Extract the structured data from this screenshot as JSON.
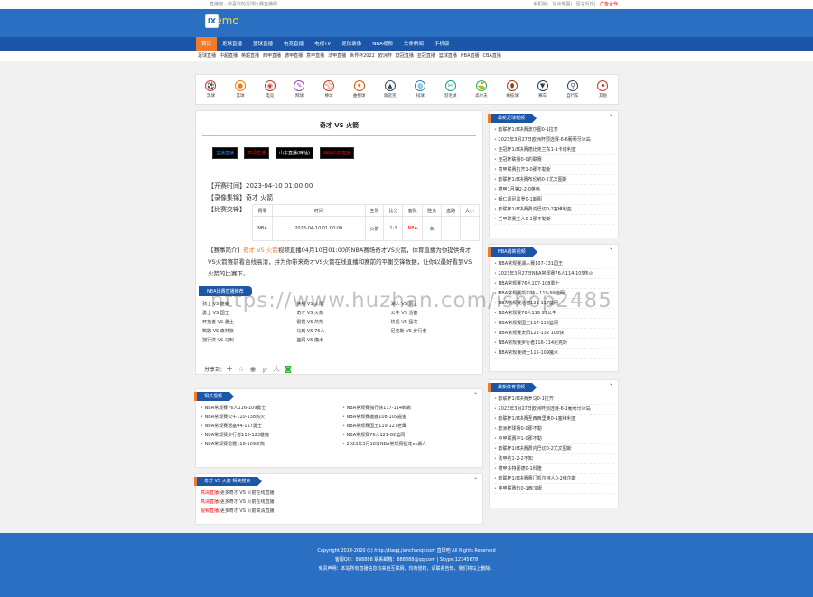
{
  "topbar": {
    "left": "直播吧 - 你喜欢的足球比赛直播网",
    "links": [
      "手机版",
      "站点地图",
      "留言反馈"
    ],
    "ad": "广告合作"
  },
  "logo": {
    "mark": "IX",
    "text": "Demo"
  },
  "nav": [
    "首页",
    "足球直播",
    "篮球直播",
    "电竞直播",
    "电视TV",
    "足球录像",
    "NBA视频",
    "头条新闻",
    "手机版"
  ],
  "subnav": [
    "足球直播",
    "中超直播",
    "英超直播",
    "西甲直播",
    "德甲直播",
    "意甲直播",
    "法甲直播",
    "世界杯2022",
    "欧洲杯",
    "欧冠直播",
    "亚冠直播",
    "篮球直播",
    "NBA直播",
    "CBA直播"
  ],
  "sports": [
    {
      "label": "足球",
      "icon": "soccer-icon",
      "color": "#c0392b",
      "glyph": "⚽"
    },
    {
      "label": "篮球",
      "icon": "basketball-icon",
      "color": "#e67e22",
      "glyph": "●"
    },
    {
      "label": "电竞",
      "icon": "esports-icon",
      "color": "#c0392b",
      "glyph": "◉"
    },
    {
      "label": "网球",
      "icon": "tennis-icon",
      "color": "#8e44ad",
      "glyph": "✎"
    },
    {
      "label": "棒球",
      "icon": "baseball-icon",
      "color": "#c0392b",
      "glyph": "⚾"
    },
    {
      "label": "曲棍球",
      "icon": "hockey-icon",
      "color": "#d35400",
      "glyph": "✶"
    },
    {
      "label": "斯诺克",
      "icon": "snooker-icon",
      "color": "#34495e",
      "glyph": "▲"
    },
    {
      "label": "排球",
      "icon": "volleyball-icon",
      "color": "#2980b9",
      "glyph": "◍"
    },
    {
      "label": "羽毛球",
      "icon": "badminton-icon",
      "color": "#16a085",
      "glyph": "✂"
    },
    {
      "label": "高尔夫",
      "icon": "golf-icon",
      "color": "#27ae60",
      "glyph": "⛳"
    },
    {
      "label": "橄榄球",
      "icon": "rugby-icon",
      "color": "#8b4513",
      "glyph": "⬮"
    },
    {
      "label": "赛车",
      "icon": "racing-icon",
      "color": "#2c3e50",
      "glyph": "▼"
    },
    {
      "label": "自行车",
      "icon": "cycling-icon",
      "color": "#2c3e50",
      "glyph": "⚲"
    },
    {
      "label": "其他",
      "icon": "other-sports-icon",
      "color": "#c0392b",
      "glyph": "♦"
    }
  ],
  "match": {
    "title": "奇才 VS 火箭",
    "buttons": [
      {
        "label": "主播直播",
        "color": "#3a7bd5"
      },
      {
        "label": "高清直播",
        "color": "#e00"
      },
      {
        "label": "山东直播(咪咕)",
        "color": "#fff"
      },
      {
        "label": "咪咕山东直播",
        "color": "#e00"
      }
    ],
    "time_label": "【开赛时间】",
    "time": "2023-04-10 01:00:00",
    "team_label": "【录像集锦】",
    "teams": "奇才 火箭",
    "odds_label": "【比赛交锋】",
    "table_head": [
      "赛事",
      "时间",
      "主队",
      "比分",
      "客队",
      "胜负",
      "盘路",
      "大小"
    ],
    "table_row": [
      "NBA",
      "2023-04-10 01:00:00",
      "火箭",
      "1:2",
      "NBA",
      "负",
      "",
      ""
    ],
    "intro_label": "【赛事简介】",
    "intro_hl": "奇才 VS 火箭",
    "intro": "视频直播04月10日01:00的NBA赛场奇才VS火箭，体育直播为你提供奇才VS火箭赛前看台线高清，并为你带来奇才VS火箭在线直播和赛前的平衡交锋数据，让你以最好看到VS火箭的比赛下。"
  },
  "related_live": {
    "tab": "NBA比赛直播推荐",
    "items": [
      "骑士 VS 雄鹿",
      "快船 VS 太阳",
      "湖人 VS 爵士",
      "勇士 VS 国王",
      "奇才 VS 火箭",
      "公牛 VS 活塞",
      "开拓者 VS 勇士",
      "雷霆 VS 灰熊",
      "快船 VS 猛龙",
      "鹈鹕 VS 森林狼",
      "马刺 VS 76人",
      "尼克斯 VS 步行者",
      "独行侠 VS 马刺",
      "篮网 VS 魔术"
    ]
  },
  "share": {
    "label": "分享到:",
    "icons": [
      "plus-icon",
      "star-icon",
      "weibo-icon",
      "qzone-icon",
      "renren-icon",
      "wechat-icon"
    ]
  },
  "xglist": {
    "tab": "相关视频",
    "items": [
      "NBA常规赛76人116-109勇士",
      "NBA常规赛独行侠117-114鹈鹕",
      "NBA常规赛公牛110-138热火",
      "NBA常规赛雄鹿108-109掘金",
      "NBA常规赛活塞94-117勇士",
      "NBA常规赛国王119-127老鹰",
      "NBA常规赛步行者118-123雄鹿",
      "NBA常规赛76人121-82篮网",
      "NBA常规赛雷霆118-109灰熊",
      "2023年3月18日NBA常规赛猛龙vs湖人"
    ]
  },
  "tags": {
    "tab": "奇才 VS 火箭 相关搜索",
    "items": [
      {
        "t": "高清直播:",
        "v": "更多奇才 VS 火箭在线直播"
      },
      {
        "t": "高清直播:",
        "v": "更多奇才 VS 火箭在线直播"
      },
      {
        "t": "视频直播:",
        "v": "更多奇才 VS 火箭高清直播"
      }
    ]
  },
  "side1": {
    "head": "最新足球视频",
    "items": [
      "欧联杯1/8决赛波尔图0-1拉齐",
      "2023年3月27日欧洲杯预选赛-6-6葡萄牙冰岛",
      "亚冠杯1/8决赛德比克兰东1-1卡塔利亚",
      "亚冠杯联赛0-0的联赛",
      "意甲联赛拉齐1-0那不勒斯",
      "欧联杯1/8决赛布伦纳0-2尤文图斯",
      "德甲1月第2-2-0英伟",
      "拜仁慕尼黑罗0-1斯图",
      "欧联杯1/8决赛费内巴切0-2塞维利亚",
      "兰甲联赛主人0-1那不勒斯"
    ]
  },
  "side2": {
    "head": "NBA最新视频",
    "items": [
      "NBA常规赛湖人赛107-131国王",
      "2023年3月27日NBA常规赛76人114-105热火",
      "NBA常规赛76人107-108勇士",
      "NBA常规赛凯尔特人119-99篮网",
      "NBA常规赛活塞121-117篮网",
      "NBA常规赛76人116 91公牛",
      "NBA常规赛国王117-115篮网",
      "NBA常规赛太阳121-132 108快",
      "NBA常规赛步行者116-114尼克斯",
      "NBA常规赛骑士115-109魔术"
    ]
  },
  "side3": {
    "head": "最新体育视频",
    "items": [
      "欧联杯1/8决赛罗马0-1拉齐",
      "2023年3月27日欧洲杯预选赛-6-1葡萄牙冰岛",
      "欧联杯1/8决赛圣西西里奥0-1塞维利亚",
      "欧洲杯球赛0-0那不勒",
      "中甲联赛冲1-0那不勒",
      "欧联杯1/8决赛费内巴切0-2尤文图斯",
      "法甲约1-2-2不知",
      "德甲多特蒙德0-1科隆",
      "欧联杯1/8决赛赛门凯尔特人0-2维尔斯",
      "英甲联赛伍0-1西汉姆"
    ]
  },
  "footer": {
    "line1": "Copyright 2014-2020 (c) http://tiaqq.jianchanqi.com 直球吧 All Rights Reserved",
    "line2": "客服QQ：888888 联系邮箱：888888@qq.com | Skype:12345678",
    "line3": "免责声明：本站所有直播信息均来自互联网，均有侵权，请联系告知，我们将马上删除。"
  },
  "watermark": "https://www.huzhan.com/ishop2485"
}
